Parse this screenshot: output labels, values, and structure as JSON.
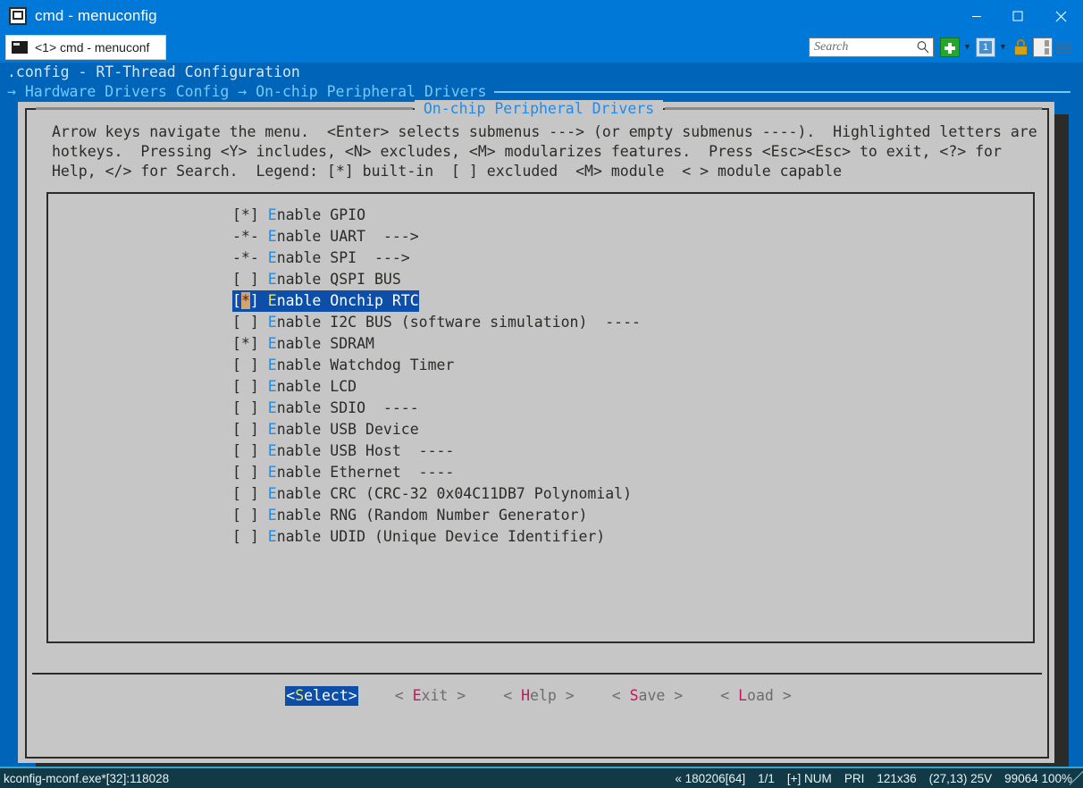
{
  "window": {
    "title": "cmd - menuconfig",
    "app_icon": "console-icon",
    "minimize_label": "minimize-icon",
    "maximize_label": "maximize-icon",
    "close_label": "close-icon"
  },
  "tabstrip": {
    "tab_label": "<1> cmd - menuconf",
    "search": {
      "placeholder": "Search",
      "value": "",
      "icon": "search-icon"
    },
    "toolbar_icons": [
      "new-tab-icon",
      "new-tab-dropdown-caret",
      "window-list-icon",
      "window-list-dropdown-caret",
      "lock-icon",
      "split-pane-icon",
      "hamburger-menu-icon"
    ],
    "caret_glyph": "▼"
  },
  "kconfig": {
    "header_title": ".config - RT-Thread Configuration",
    "breadcrumb": "→ Hardware Drivers Config → On-chip Peripheral Drivers",
    "dialog_title": "On-chip Peripheral Drivers",
    "help_lines": [
      "Arrow keys navigate the menu.  <Enter> selects submenus ---> (or empty submenus ----).  Highlighted letters are",
      "hotkeys.  Pressing <Y> includes, <N> excludes, <M> modularizes features.  Press <Esc><Esc> to exit, <?> for",
      "Help, </> for Search.  Legend: [*] built-in  [ ] excluded  <M> module  < > module capable"
    ],
    "menu_items": [
      {
        "mark": "[*]",
        "pre": "",
        "hot": "E",
        "rest": "nable GPIO",
        "selected": false,
        "cursor": false
      },
      {
        "mark": "-*-",
        "pre": "",
        "hot": "E",
        "rest": "nable UART  --->",
        "selected": false,
        "cursor": false
      },
      {
        "mark": "-*-",
        "pre": "",
        "hot": "E",
        "rest": "nable SPI  --->",
        "selected": false,
        "cursor": false
      },
      {
        "mark": "[ ]",
        "pre": "",
        "hot": "E",
        "rest": "nable QSPI BUS",
        "selected": false,
        "cursor": false
      },
      {
        "mark": "[*]",
        "pre": "",
        "hot": "E",
        "rest": "nable Onchip RTC",
        "selected": true,
        "cursor": true
      },
      {
        "mark": "[ ]",
        "pre": "",
        "hot": "E",
        "rest": "nable I2C BUS (software simulation)  ----",
        "selected": false,
        "cursor": false
      },
      {
        "mark": "[*]",
        "pre": "",
        "hot": "E",
        "rest": "nable SDRAM",
        "selected": false,
        "cursor": false
      },
      {
        "mark": "[ ]",
        "pre": "",
        "hot": "E",
        "rest": "nable Watchdog Timer",
        "selected": false,
        "cursor": false
      },
      {
        "mark": "[ ]",
        "pre": "",
        "hot": "E",
        "rest": "nable LCD",
        "selected": false,
        "cursor": false
      },
      {
        "mark": "[ ]",
        "pre": "",
        "hot": "E",
        "rest": "nable SDIO  ----",
        "selected": false,
        "cursor": false
      },
      {
        "mark": "[ ]",
        "pre": "",
        "hot": "E",
        "rest": "nable USB Device",
        "selected": false,
        "cursor": false
      },
      {
        "mark": "[ ]",
        "pre": "",
        "hot": "E",
        "rest": "nable USB Host  ----",
        "selected": false,
        "cursor": false
      },
      {
        "mark": "[ ]",
        "pre": "",
        "hot": "E",
        "rest": "nable Ethernet  ----",
        "selected": false,
        "cursor": false
      },
      {
        "mark": "[ ]",
        "pre": "",
        "hot": "E",
        "rest": "nable CRC (CRC-32 0x04C11DB7 Polynomial)",
        "selected": false,
        "cursor": false
      },
      {
        "mark": "[ ]",
        "pre": "",
        "hot": "E",
        "rest": "nable RNG (Random Number Generator)",
        "selected": false,
        "cursor": false
      },
      {
        "mark": "[ ]",
        "pre": "",
        "hot": "E",
        "rest": "nable UDID (Unique Device Identifier)",
        "selected": false,
        "cursor": false
      }
    ],
    "buttons": [
      {
        "left": "<",
        "hot": "S",
        "rest": "elect",
        "right": ">",
        "selected": true
      },
      {
        "left": "< ",
        "hot": "E",
        "rest": "xit",
        "right": " >",
        "selected": false
      },
      {
        "left": "< ",
        "hot": "H",
        "rest": "elp",
        "right": " >",
        "selected": false
      },
      {
        "left": "< ",
        "hot": "S",
        "rest": "ave",
        "right": " >",
        "selected": false
      },
      {
        "left": "< ",
        "hot": "L",
        "rest": "oad",
        "right": " >",
        "selected": false
      }
    ]
  },
  "statusbar": {
    "left": "kconfig-mconf.exe*[32]:118028",
    "right": [
      "« 180206[64]",
      "1/1",
      "[+] NUM",
      "PRI",
      "121x36",
      "(27,13) 25V",
      "99064 100%"
    ]
  },
  "colors": {
    "titlebar_blue": "#0078d7",
    "console_blue": "#0064b8",
    "dialog_gray": "#c6c6c6",
    "dialog_border": "#2b2b28",
    "hotkey_blue": "#1f8bf0",
    "selection_blue": "#0d4fa8",
    "selection_hotkey": "#e9e36a",
    "cursor_tan": "#d2a472",
    "button_hotkey_red": "#c2185b",
    "breadcrumb_cyan": "#78c8f5",
    "statusbar_teal": "#123a46"
  }
}
